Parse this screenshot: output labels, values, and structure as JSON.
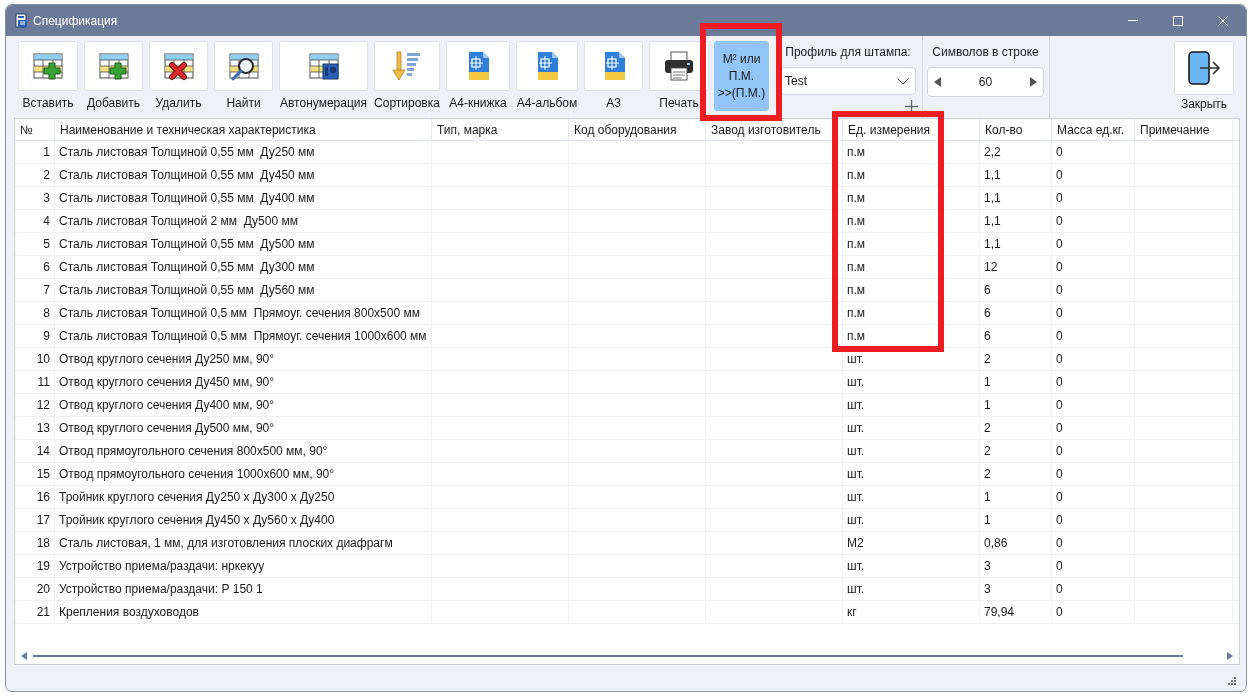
{
  "window": {
    "title": "Спецификация"
  },
  "toolbar": {
    "buttons": [
      {
        "kind": "insert",
        "label": "Вставить"
      },
      {
        "kind": "add",
        "label": "Добавить"
      },
      {
        "kind": "delete",
        "label": "Удалить"
      },
      {
        "kind": "find",
        "label": "Найти"
      },
      {
        "kind": "autonumber",
        "label": "Автонумерация"
      },
      {
        "kind": "sort",
        "label": "Сортировка"
      },
      {
        "kind": "dwg",
        "label": "A4-книжка"
      },
      {
        "kind": "dwg",
        "label": "A4-альбом"
      },
      {
        "kind": "dwg",
        "label": "A3"
      },
      {
        "kind": "print",
        "label": "Печать"
      }
    ],
    "mode_button": {
      "lines": [
        "М² или",
        "П.М.",
        ">>(П.М.)"
      ],
      "on": true,
      "framed": true
    },
    "profile": {
      "label": "Профиль для штампа:",
      "value": "Test"
    },
    "chars_per_line": {
      "label": "Символов в строке",
      "value": "60"
    },
    "close_button": {
      "label": "Закрыть"
    }
  },
  "table": {
    "columns": [
      {
        "label": "№",
        "framed": false
      },
      {
        "label": "Наименование и техническая характеристика",
        "framed": false
      },
      {
        "label": "Тип, марка",
        "framed": false
      },
      {
        "label": "Код оборудования",
        "framed": false
      },
      {
        "label": "Завод изготовитель",
        "framed": false
      },
      {
        "label": "Ед. измерения",
        "framed": true
      },
      {
        "label": "Кол-во",
        "framed": false
      },
      {
        "label": "Масса ед.кг.",
        "framed": false
      },
      {
        "label": "Примечание",
        "framed": false
      }
    ],
    "rows": [
      {
        "no": "1",
        "name": "Сталь листовая Толщиной 0,55 мм  Ду250 мм",
        "unit": "п.м",
        "qty": "2,2",
        "mass": "0"
      },
      {
        "no": "2",
        "name": "Сталь листовая Толщиной 0,55 мм  Ду450 мм",
        "unit": "п.м",
        "qty": "1,1",
        "mass": "0"
      },
      {
        "no": "3",
        "name": "Сталь листовая Толщиной 0,55 мм  Ду400 мм",
        "unit": "п.м",
        "qty": "1,1",
        "mass": "0"
      },
      {
        "no": "4",
        "name": "Сталь листовая Толщиной 2 мм  Ду500 мм",
        "unit": "п.м",
        "qty": "1,1",
        "mass": "0"
      },
      {
        "no": "5",
        "name": "Сталь листовая Толщиной 0,55 мм  Ду500 мм",
        "unit": "п.м",
        "qty": "1,1",
        "mass": "0"
      },
      {
        "no": "6",
        "name": "Сталь листовая Толщиной 0,55 мм  Ду300 мм",
        "unit": "п.м",
        "qty": "12",
        "mass": "0"
      },
      {
        "no": "7",
        "name": "Сталь листовая Толщиной 0,55 мм  Ду560 мм",
        "unit": "п.м",
        "qty": "6",
        "mass": "0"
      },
      {
        "no": "8",
        "name": "Сталь листовая Толщиной 0,5 мм  Прямоуг. сечения 800х500 мм",
        "unit": "п.м",
        "qty": "6",
        "mass": "0"
      },
      {
        "no": "9",
        "name": "Сталь листовая Толщиной 0,5 мм  Прямоуг. сечения 1000х600 мм",
        "unit": "п.м",
        "qty": "6",
        "mass": "0"
      },
      {
        "no": "10",
        "name": "Отвод круглого сечения Ду250 мм, 90°",
        "unit": "шт.",
        "qty": "2",
        "mass": "0"
      },
      {
        "no": "11",
        "name": "Отвод круглого сечения Ду450 мм, 90°",
        "unit": "шт.",
        "qty": "1",
        "mass": "0"
      },
      {
        "no": "12",
        "name": "Отвод круглого сечения Ду400 мм, 90°",
        "unit": "шт.",
        "qty": "1",
        "mass": "0"
      },
      {
        "no": "13",
        "name": "Отвод круглого сечения Ду500 мм, 90°",
        "unit": "шт.",
        "qty": "2",
        "mass": "0"
      },
      {
        "no": "14",
        "name": "Отвод прямоугольного сечения 800х500 мм, 90°",
        "unit": "шт.",
        "qty": "2",
        "mass": "0"
      },
      {
        "no": "15",
        "name": "Отвод прямоугольного сечения 1000х600 мм, 90°",
        "unit": "шт.",
        "qty": "2",
        "mass": "0"
      },
      {
        "no": "16",
        "name": "Тройник круглого сечения Ду250 х Ду300 х Ду250",
        "unit": "шт.",
        "qty": "1",
        "mass": "0"
      },
      {
        "no": "17",
        "name": "Тройник круглого сечения Ду450 х Ду560 х Ду400",
        "unit": "шт.",
        "qty": "1",
        "mass": "0"
      },
      {
        "no": "18",
        "name": "Сталь листовая, 1 мм, для изготовления плоских диафрагм",
        "unit": "М2",
        "qty": "0,86",
        "mass": "0"
      },
      {
        "no": "19",
        "name": "Устройство приема/раздачи: нркекуу",
        "unit": "шт.",
        "qty": "3",
        "mass": "0"
      },
      {
        "no": "20",
        "name": "Устройство приема/раздачи: Р 150 1",
        "unit": "шт.",
        "qty": "3",
        "mass": "0"
      },
      {
        "no": "21",
        "name": "Крепления воздуховодов",
        "unit": "кг",
        "qty": "79,94",
        "mass": "0"
      }
    ]
  }
}
